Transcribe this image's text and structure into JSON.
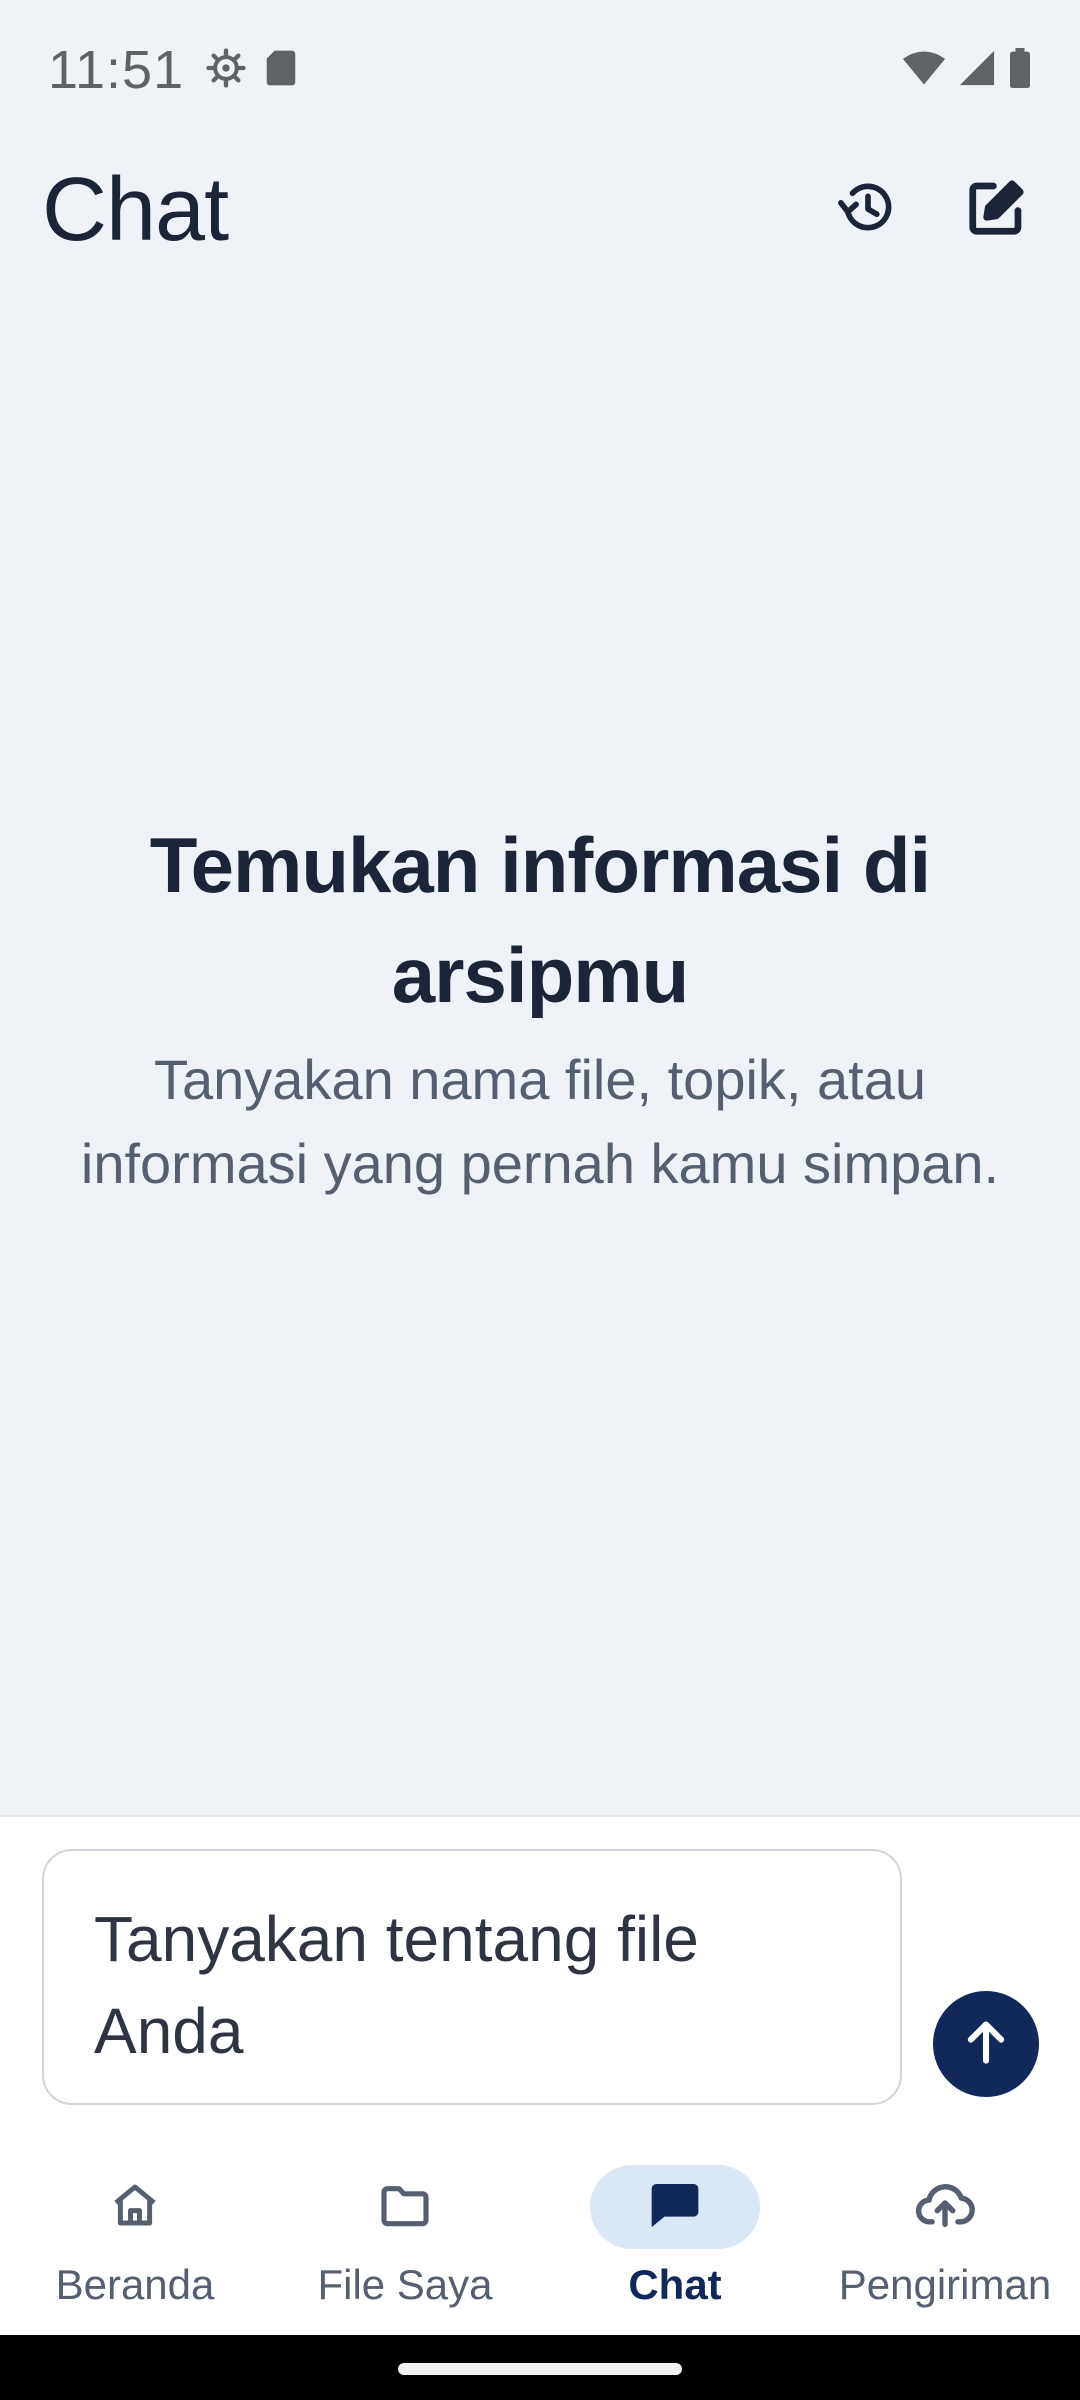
{
  "status_bar": {
    "time": "11:51",
    "left_icons": [
      "settings-gear-icon",
      "sd-card-icon"
    ],
    "right_icons": [
      "wifi-icon",
      "cellular-signal-icon",
      "battery-icon"
    ]
  },
  "app_bar": {
    "title": "Chat",
    "actions": [
      {
        "name": "history-button",
        "icon": "history-icon"
      },
      {
        "name": "new-chat-button",
        "icon": "edit-icon"
      }
    ]
  },
  "empty_state": {
    "title": "Temukan informasi di arsipmu",
    "subtitle": "Tanyakan nama file, topik, atau informasi yang pernah kamu simpan."
  },
  "composer": {
    "placeholder": "Tanyakan tentang file Anda",
    "send_icon": "arrow-up-icon"
  },
  "bottom_nav": {
    "items": [
      {
        "label": "Beranda",
        "icon": "home-icon",
        "active": false
      },
      {
        "label": "File Saya",
        "icon": "folder-icon",
        "active": false
      },
      {
        "label": "Chat",
        "icon": "chat-icon",
        "active": true
      },
      {
        "label": "Pengiriman",
        "icon": "cloud-upload-icon",
        "active": false
      }
    ]
  },
  "colors": {
    "background": "#eff3f7",
    "primary": "#12275a",
    "active_pill": "#dae8f6",
    "text_dark": "#1c2537",
    "text_muted": "#555f70"
  }
}
